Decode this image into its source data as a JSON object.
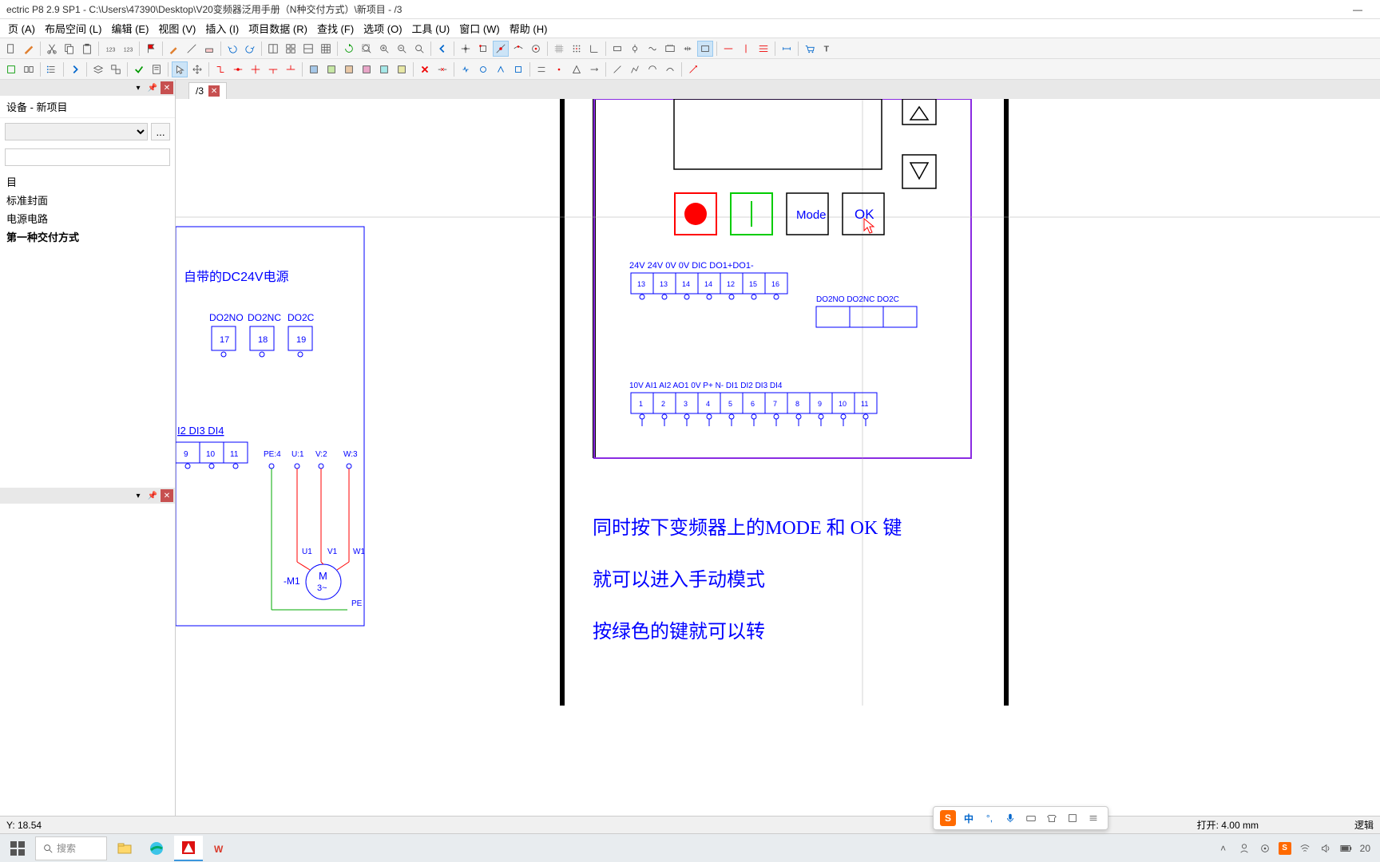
{
  "window": {
    "title": "ectric P8 2.9 SP1 - C:\\Users\\47390\\Desktop\\V20变频器泛用手册（N种交付方式）\\新项目 - /3"
  },
  "menus": [
    {
      "label": "页 (A)"
    },
    {
      "label": "布局空间 (L)"
    },
    {
      "label": "编辑 (E)"
    },
    {
      "label": "视图 (V)"
    },
    {
      "label": "插入 (I)"
    },
    {
      "label": "项目数据 (R)"
    },
    {
      "label": "查找 (F)"
    },
    {
      "label": "选项 (O)"
    },
    {
      "label": "工具 (U)"
    },
    {
      "label": "窗口 (W)"
    },
    {
      "label": "帮助 (H)"
    }
  ],
  "sidebar": {
    "device_label": "设备 - 新项目",
    "tree": [
      {
        "label": "目",
        "bold": false
      },
      {
        "label": "标准封面",
        "bold": false
      },
      {
        "label": "电源电路",
        "bold": false
      },
      {
        "label": "第一种交付方式",
        "bold": true
      }
    ]
  },
  "tabs": [
    {
      "label": "/3"
    }
  ],
  "drawing": {
    "dc24v_label": "自带的DC24V电源",
    "do_terminals": [
      {
        "name": "DO2NO",
        "num": "17"
      },
      {
        "name": "DO2NC",
        "num": "18"
      },
      {
        "name": "DO2C",
        "num": "19"
      }
    ],
    "di_labels": [
      "I2",
      "DI3",
      "DI4"
    ],
    "di_row": [
      {
        "num": "9"
      },
      {
        "num": "10"
      },
      {
        "num": "11"
      },
      {
        "label": "PE:4"
      },
      {
        "label": "U:1"
      },
      {
        "label": "V:2"
      },
      {
        "label": "W:3"
      }
    ],
    "motor": {
      "tag": "-M1",
      "text1": "M",
      "text2": "3~",
      "U": "U1",
      "V": "V1",
      "W": "W1",
      "PE": "PE"
    },
    "panel": {
      "buttons": {
        "mode": "Mode",
        "ok": "OK"
      },
      "upper_terminals": {
        "labels": [
          "24V",
          "24V",
          "0V",
          "0V",
          "DIC",
          "DO1+DO1-"
        ],
        "nums": [
          "13",
          "13",
          "14",
          "14",
          "12",
          "15",
          "16"
        ]
      },
      "do2_terminals": [
        "DO2NO",
        "DO2NC",
        "DO2C"
      ],
      "lower_terminals": {
        "labels": [
          "10V",
          "AI1",
          "AI2",
          "AO1",
          "0V",
          "P+",
          "N-",
          "DI1",
          "DI2",
          "DI3",
          "DI4"
        ],
        "nums": [
          "1",
          "2",
          "3",
          "4",
          "5",
          "6",
          "7",
          "8",
          "9",
          "10",
          "11"
        ]
      }
    },
    "instructions": {
      "line1": "同时按下变频器上的MODE 和   OK 键",
      "line2": "就可以进入手动模式",
      "line3": "按绿色的键就可以转"
    }
  },
  "status": {
    "xy": "Y: 18.54",
    "open": "打开: 4.00 mm",
    "logic": "逻辑"
  },
  "ime": {
    "zhong": "中"
  },
  "taskbar": {
    "search_placeholder": "搜索",
    "time": "20"
  }
}
